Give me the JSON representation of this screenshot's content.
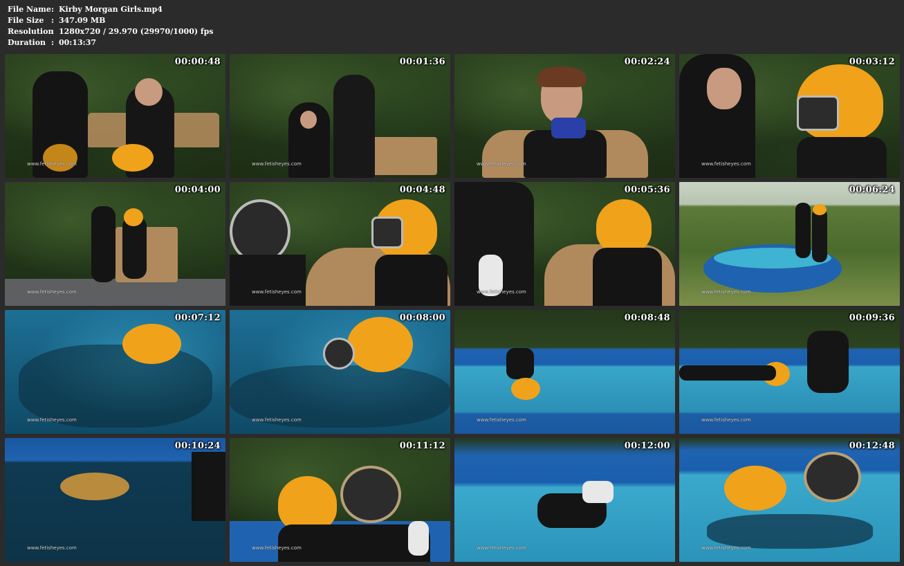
{
  "file_info": {
    "rows": [
      {
        "key": "File Name",
        "sep": ":",
        "value": "Kirby Morgan Girls.mp4"
      },
      {
        "key": "File Size",
        "sep": ":",
        "value": "347.09 MB"
      },
      {
        "key": "Resolution",
        "sep": ":",
        "value": "1280x720 / 29.970 (29970/1000) fps"
      },
      {
        "key": "Duration",
        "sep": ":",
        "value": "00:13:37"
      }
    ]
  },
  "thumbnails": [
    {
      "timestamp": "00:00:48",
      "watermark": "www.fetisheyes.com"
    },
    {
      "timestamp": "00:01:36",
      "watermark": "www.fetisheyes.com"
    },
    {
      "timestamp": "00:02:24",
      "watermark": "www.fetisheyes.com"
    },
    {
      "timestamp": "00:03:12",
      "watermark": "www.fetisheyes.com"
    },
    {
      "timestamp": "00:04:00",
      "watermark": "www.fetisheyes.com"
    },
    {
      "timestamp": "00:04:48",
      "watermark": "www.fetisheyes.com"
    },
    {
      "timestamp": "00:05:36",
      "watermark": "www.fetisheyes.com"
    },
    {
      "timestamp": "00:06:24",
      "watermark": "www.fetisheyes.com"
    },
    {
      "timestamp": "00:07:12",
      "watermark": "www.fetisheyes.com"
    },
    {
      "timestamp": "00:08:00",
      "watermark": "www.fetisheyes.com"
    },
    {
      "timestamp": "00:08:48",
      "watermark": "www.fetisheyes.com"
    },
    {
      "timestamp": "00:09:36",
      "watermark": "www.fetisheyes.com"
    },
    {
      "timestamp": "00:10:24",
      "watermark": "www.fetisheyes.com"
    },
    {
      "timestamp": "00:11:12",
      "watermark": "www.fetisheyes.com"
    },
    {
      "timestamp": "00:12:00",
      "watermark": "www.fetisheyes.com"
    },
    {
      "timestamp": "00:12:48",
      "watermark": "www.fetisheyes.com"
    }
  ],
  "colors": {
    "background": "#2b2b2b",
    "text": "#ffffff",
    "helmet": "#f0a21a",
    "wetsuit": "#141414",
    "bench": "#b08a5c",
    "pool_wall": "#1f63b0",
    "water": "#2b9bc0"
  }
}
